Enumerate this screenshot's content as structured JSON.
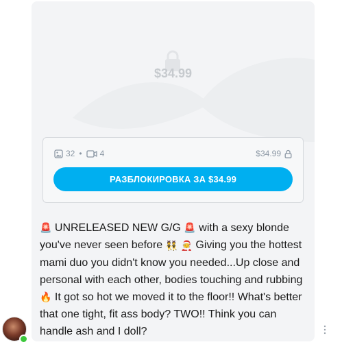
{
  "locked_post": {
    "price_overlay": "$34.99",
    "media": {
      "photo_count": "32",
      "separator": "•",
      "video_count": "4"
    },
    "price": "$34.99",
    "unlock_button_label": "РАЗБЛОКИРОВКА ЗА $34.99"
  },
  "message": {
    "line1_a": "UNRELEASED NEW G/G",
    "line1_b": "with a sexy blonde",
    "line2_a": "you've never seen before",
    "line2_b": "Giving you the hottest",
    "line3": "mami duo you didn't know you needed...Up close and",
    "line4": "personal with each other, bodies touching and rubbing",
    "line5_b": "It got so hot we moved it to the floor!! What's better",
    "line6": "that one tight, fit ass body? TWO!! Think you can",
    "line7": "handle ash and I doll?",
    "emojis": {
      "siren1": "🚨",
      "siren2": "🚨",
      "couple": "👯",
      "santa": "🧑‍🎄",
      "fire": "🔥"
    }
  },
  "colors": {
    "accent": "#00aff0",
    "card_bg": "#f3f4f6",
    "muted_text": "#8a96a3",
    "online": "#3cc83c"
  },
  "icons": [
    "lock-icon",
    "image-icon",
    "video-icon",
    "more-vertical-icon"
  ]
}
